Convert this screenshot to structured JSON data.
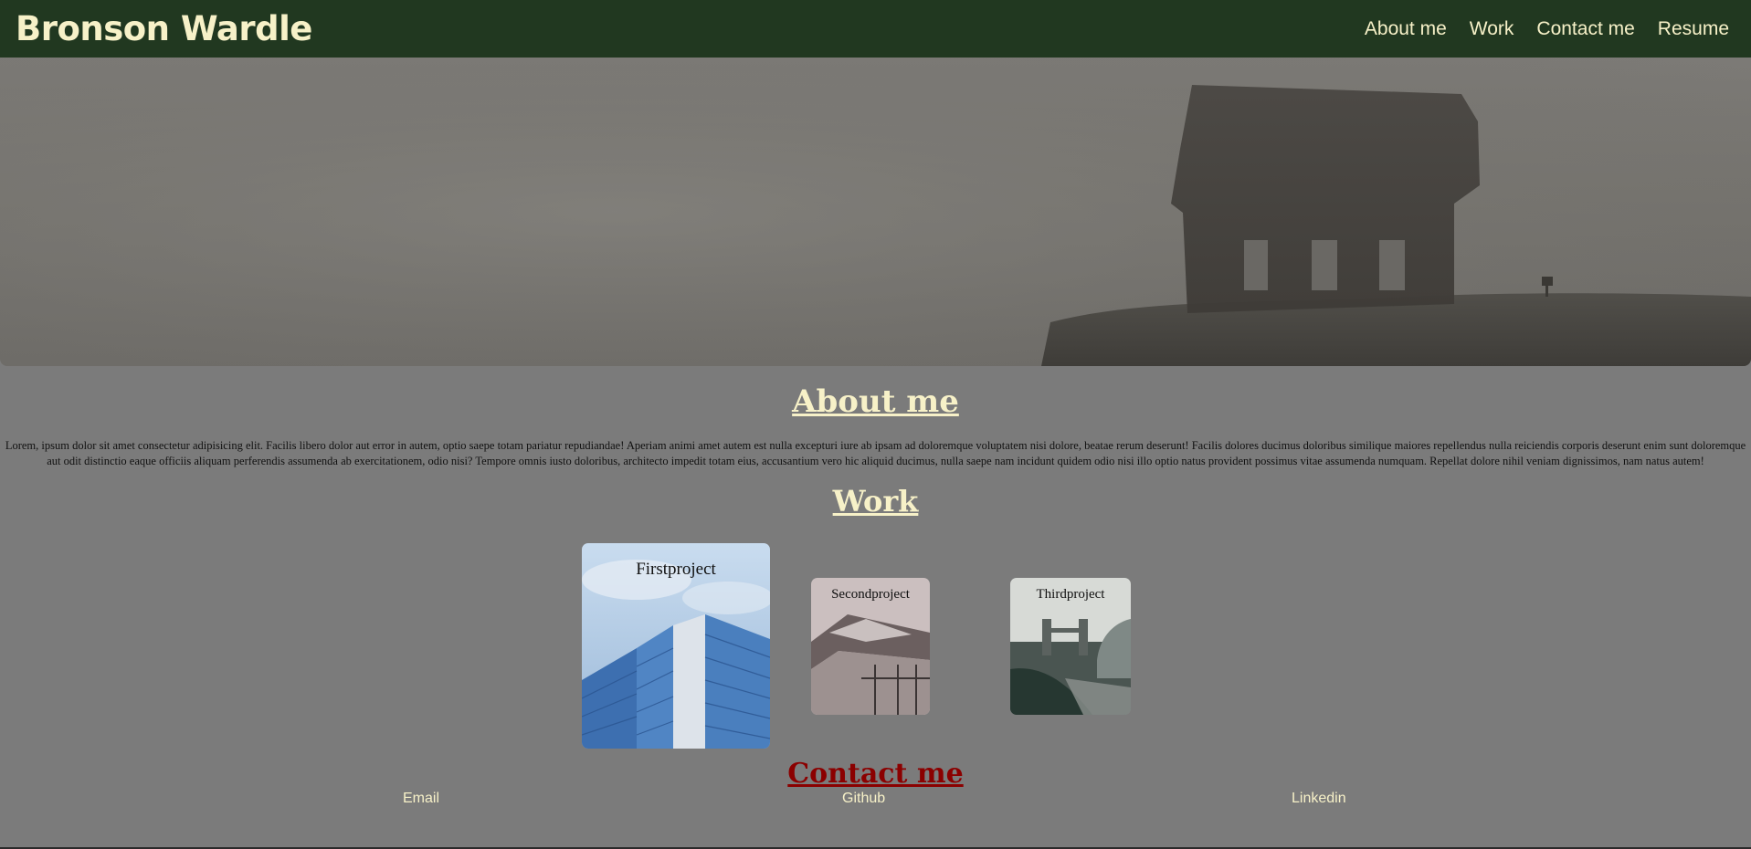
{
  "header": {
    "brand": "Bronson Wardle",
    "nav": [
      "About me",
      "Work",
      "Contact me",
      "Resume"
    ]
  },
  "about": {
    "title": "About me",
    "text": "Lorem, ipsum dolor sit amet consectetur adipisicing elit. Facilis libero dolor aut error in autem, optio saepe totam pariatur repudiandae! Aperiam animi amet autem est nulla excepturi iure ab ipsam ad doloremque voluptatem nisi dolore, beatae rerum deserunt! Facilis dolores ducimus doloribus similique maiores repellendus nulla reiciendis corporis deserunt enim sunt doloremque aut odit distinctio eaque officiis aliquam perferendis assumenda ab exercitationem, odio nisi? Tempore omnis iusto doloribus, architecto impedit totam eius, accusantium vero hic aliquid ducimus, nulla saepe nam incidunt quidem odio nisi illo optio natus provident possimus vitae assumenda numquam. Repellat dolore nihil veniam dignissimos, nam natus autem!"
  },
  "work": {
    "title": "Work",
    "projects": [
      "Firstproject",
      "Secondproject",
      "Thirdproject"
    ]
  },
  "contact": {
    "title": "Contact me",
    "links": [
      "Email",
      "Github",
      "Linkedin"
    ]
  },
  "colors": {
    "header_bg": "#213820",
    "page_bg": "#7b7b7b",
    "accent_text": "#f7f1c8",
    "contact_title": "#8b0000"
  }
}
